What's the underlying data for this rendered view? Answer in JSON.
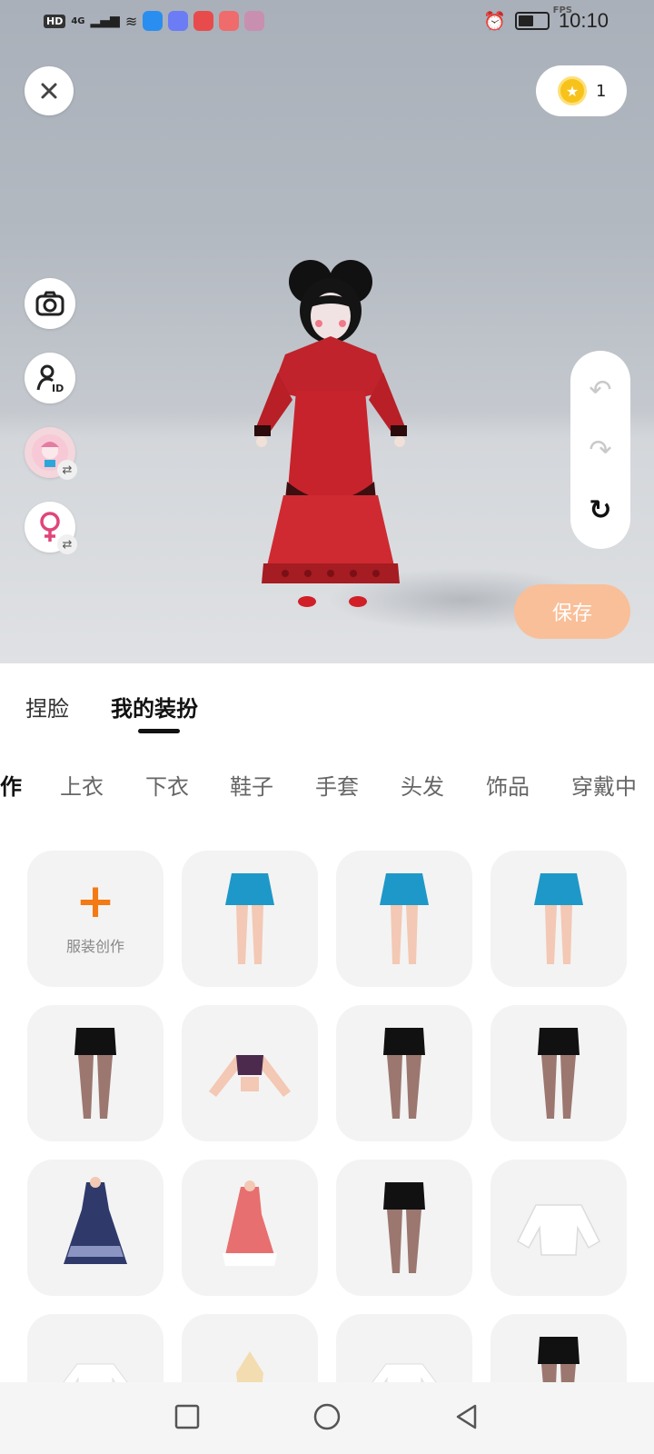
{
  "status_bar": {
    "hd": "HD",
    "network": "4G",
    "fps": "FPS",
    "time": "10:10"
  },
  "header": {
    "coin_count": "1"
  },
  "actions": {
    "save_label": "保存"
  },
  "tabs": [
    {
      "label": "捏脸",
      "active": false
    },
    {
      "label": "我的装扮",
      "active": true
    }
  ],
  "categories": [
    "作",
    "上衣",
    "下衣",
    "鞋子",
    "手套",
    "头发",
    "饰品",
    "穿戴中"
  ],
  "grid": {
    "create_label": "服装创作",
    "items": [
      "create",
      "blue-skirt",
      "blue-skirt",
      "blue-skirt",
      "black-shorts",
      "purple-top",
      "black-shorts",
      "black-shorts",
      "navy-dress",
      "pink-dress",
      "black-shorts",
      "white-sweater",
      "white-tee",
      "gold-top",
      "white-tee",
      "black-shorts"
    ]
  },
  "colors": {
    "accent_orange": "#f47a14",
    "save_button": "#f9bf98",
    "viewer_bg": "#b3b9c1",
    "dress_red": "#c8232b"
  },
  "icons": {
    "close": "close-icon",
    "camera": "camera-icon",
    "id": "id-icon",
    "avatar": "avatar-icon",
    "gender": "female-icon",
    "undo": "undo-icon",
    "redo": "redo-icon",
    "reset": "reset-icon"
  }
}
